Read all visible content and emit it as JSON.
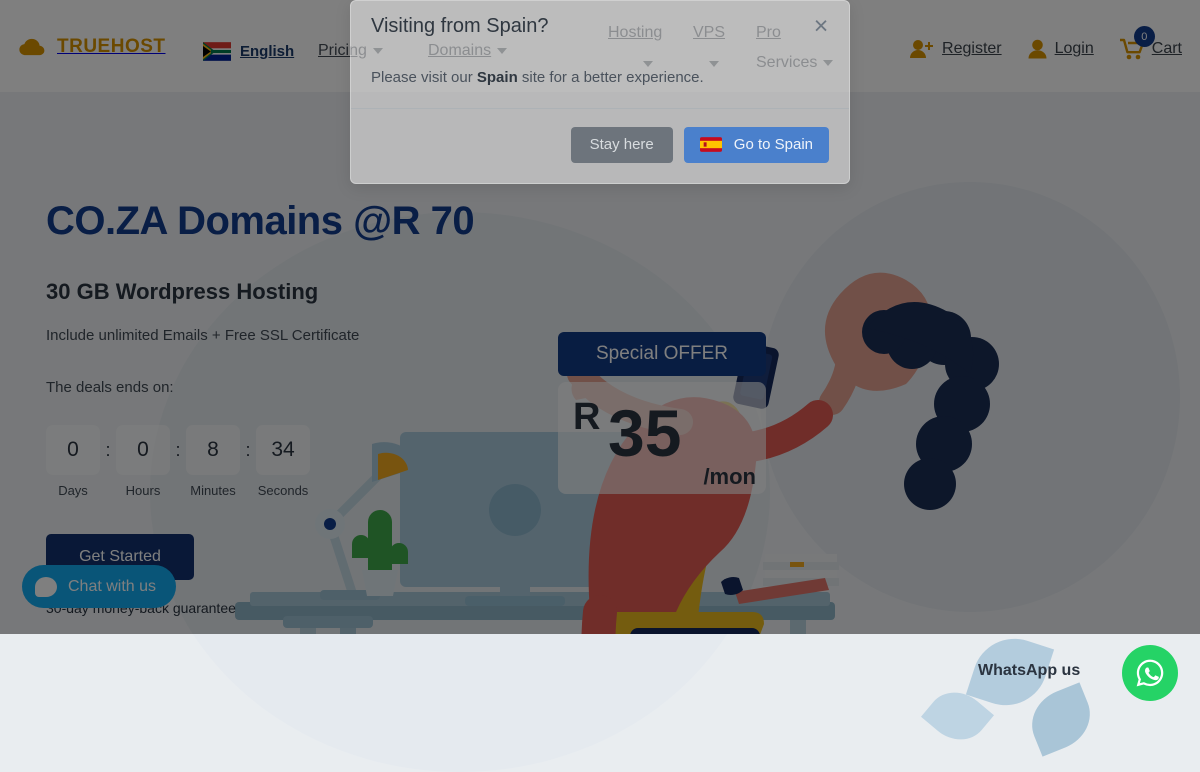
{
  "brand": {
    "name": "TRUEHOST",
    "logo_icon": "cloud-icon",
    "color": "#d79200"
  },
  "nav": {
    "language": {
      "label": "English",
      "flag": "south-africa-flag"
    },
    "items": [
      {
        "label": "Pricing",
        "has_caret": true
      },
      {
        "label": "Domains",
        "has_caret": true
      },
      {
        "label": "Hosting",
        "has_caret": true
      },
      {
        "label": "VPS",
        "has_caret": true
      },
      {
        "label": "Pro",
        "label2": "Services",
        "has_caret": true
      }
    ],
    "account": [
      {
        "label": "Register",
        "icon": "user-plus-icon"
      },
      {
        "label": "Login",
        "icon": "user-icon"
      },
      {
        "label": "Cart",
        "icon": "shopping-cart-icon",
        "badge": "0"
      }
    ]
  },
  "hero": {
    "title": "CO.ZA Domains @R 70",
    "subtitle": "30 GB Wordpress Hosting",
    "features": "Include unlimited Emails + Free SSL Certificate",
    "deal_label": "The deals ends on:",
    "countdown": [
      {
        "value": "0",
        "label": "Days"
      },
      {
        "value": "0",
        "label": "Hours"
      },
      {
        "value": "8",
        "label": "Minutes"
      },
      {
        "value": "34",
        "label": "Seconds"
      }
    ],
    "separator": ":",
    "cta_label": "Get Started",
    "guarantee": "30-day money-back guarantee"
  },
  "offer": {
    "badge": "Special OFFER",
    "currency": "R",
    "amount": "35",
    "period": "/mon",
    "badge_color": "#113a84"
  },
  "whatsapp": {
    "label": "WhatsApp us",
    "icon": "whatsapp-icon",
    "color": "#25d366"
  },
  "chat": {
    "label": "Chat with us",
    "icon": "chat-bubble-icon",
    "color": "#12aaf0"
  },
  "modal": {
    "title": "Visiting from Spain?",
    "body_prefix": "Please visit our ",
    "body_country": "Spain",
    "body_suffix": " site for a better experience.",
    "close_icon": "close-icon",
    "stay_label": "Stay here",
    "go_label": "Go to Spain",
    "go_flag": "spain-flag",
    "go_color": "#4a80cc",
    "stay_color": "#6d747c"
  }
}
